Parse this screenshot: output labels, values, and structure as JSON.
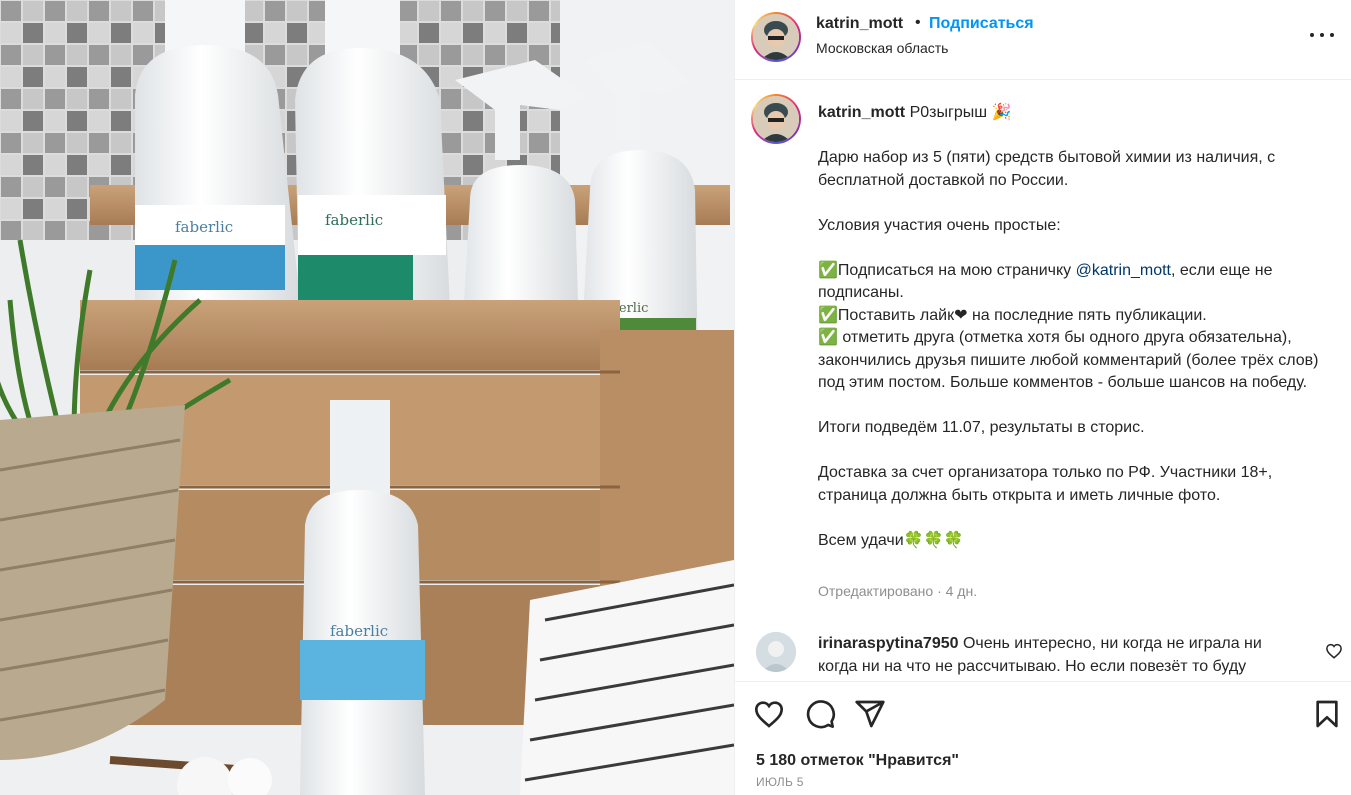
{
  "post": {
    "username": "katrin_mott",
    "separator": "•",
    "follow_label": "Подписаться",
    "location": "Московская область",
    "photo_alt": "faberlic"
  },
  "caption": {
    "username": "katrin_mott",
    "title": "Р0зыгрыш 🎉",
    "p1": "Дарю набор из 5 (пяти) средств бытовой химии из наличия, с бесплатной доставкой по России.",
    "p2": "Условия участия очень простые:",
    "p3a": "✅Подписаться на мою страничку ",
    "p3_mention": "@katrin_mott",
    "p3b": ", если еще не подписаны.",
    "p4": "✅Поставить лайк❤ на последние пять публикации.",
    "p5": "✅ отметить друга (отметка хотя бы одного друга обязательна), закончились друзья пишите любой комментарий (более трёх слов) под этим постом. Больше комментов - больше шансов на победу.",
    "p6": "Итоги подведём 11.07, результаты в сторис.",
    "p7": "Доставка за счет организатора только по РФ. Участники 18+, страница должна быть открыта и иметь личные фото.",
    "p8": "Всем удачи🍀🍀🍀",
    "meta": "Отредактировано · 4 дн."
  },
  "comment": {
    "username": "irinaraspytina7950",
    "text": " Очень интересно, ни когда не играла ни когда ни на что не рассчитываю. Но если повезёт то буду"
  },
  "actions": {
    "like_icon": "heart-icon",
    "comment_icon": "comment-icon",
    "share_icon": "share-icon",
    "save_icon": "bookmark-icon",
    "likes_text": "5 180 отметок \"Нравится\"",
    "date": "ИЮЛЬ 5"
  }
}
